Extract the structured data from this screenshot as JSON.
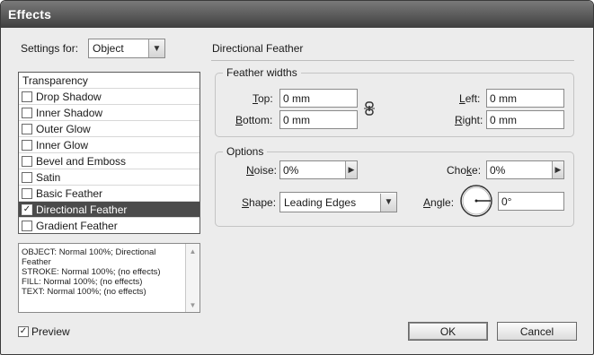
{
  "window": {
    "title": "Effects"
  },
  "settings": {
    "label": "Settings for:",
    "value": "Object"
  },
  "effects": {
    "header": "Transparency",
    "items": [
      {
        "label": "Drop Shadow",
        "checked": false
      },
      {
        "label": "Inner Shadow",
        "checked": false
      },
      {
        "label": "Outer Glow",
        "checked": false
      },
      {
        "label": "Inner Glow",
        "checked": false
      },
      {
        "label": "Bevel and Emboss",
        "checked": false
      },
      {
        "label": "Satin",
        "checked": false
      },
      {
        "label": "Basic Feather",
        "checked": false
      },
      {
        "label": "Directional Feather",
        "checked": true,
        "selected": true
      },
      {
        "label": "Gradient Feather",
        "checked": false
      }
    ]
  },
  "summary": {
    "lines": [
      "OBJECT: Normal 100%; Directional",
      "Feather",
      "STROKE: Normal 100%; (no effects)",
      "FILL: Normal 100%; (no effects)",
      "TEXT: Normal 100%; (no effects)"
    ]
  },
  "preview": {
    "label": "Preview",
    "checked": true
  },
  "panel": {
    "title": "Directional Feather",
    "feather_widths": {
      "title": "Feather widths",
      "top_label": "Top:",
      "top_value": "0 mm",
      "bottom_label": "Bottom:",
      "bottom_value": "0 mm",
      "left_label": "Left:",
      "left_value": "0 mm",
      "right_label": "Right:",
      "right_value": "0 mm",
      "link_icon": "chain-link-icon"
    },
    "options": {
      "title": "Options",
      "noise_label": "Noise:",
      "noise_value": "0%",
      "choke_label": "Choke:",
      "choke_value": "0%",
      "shape_label": "Shape:",
      "shape_value": "Leading Edges",
      "angle_label": "Angle:",
      "angle_value": "0°"
    }
  },
  "buttons": {
    "ok": "OK",
    "cancel": "Cancel"
  },
  "colors": {
    "titlebar": "#3f3f3f",
    "selected_row": "#4b4b4b"
  }
}
